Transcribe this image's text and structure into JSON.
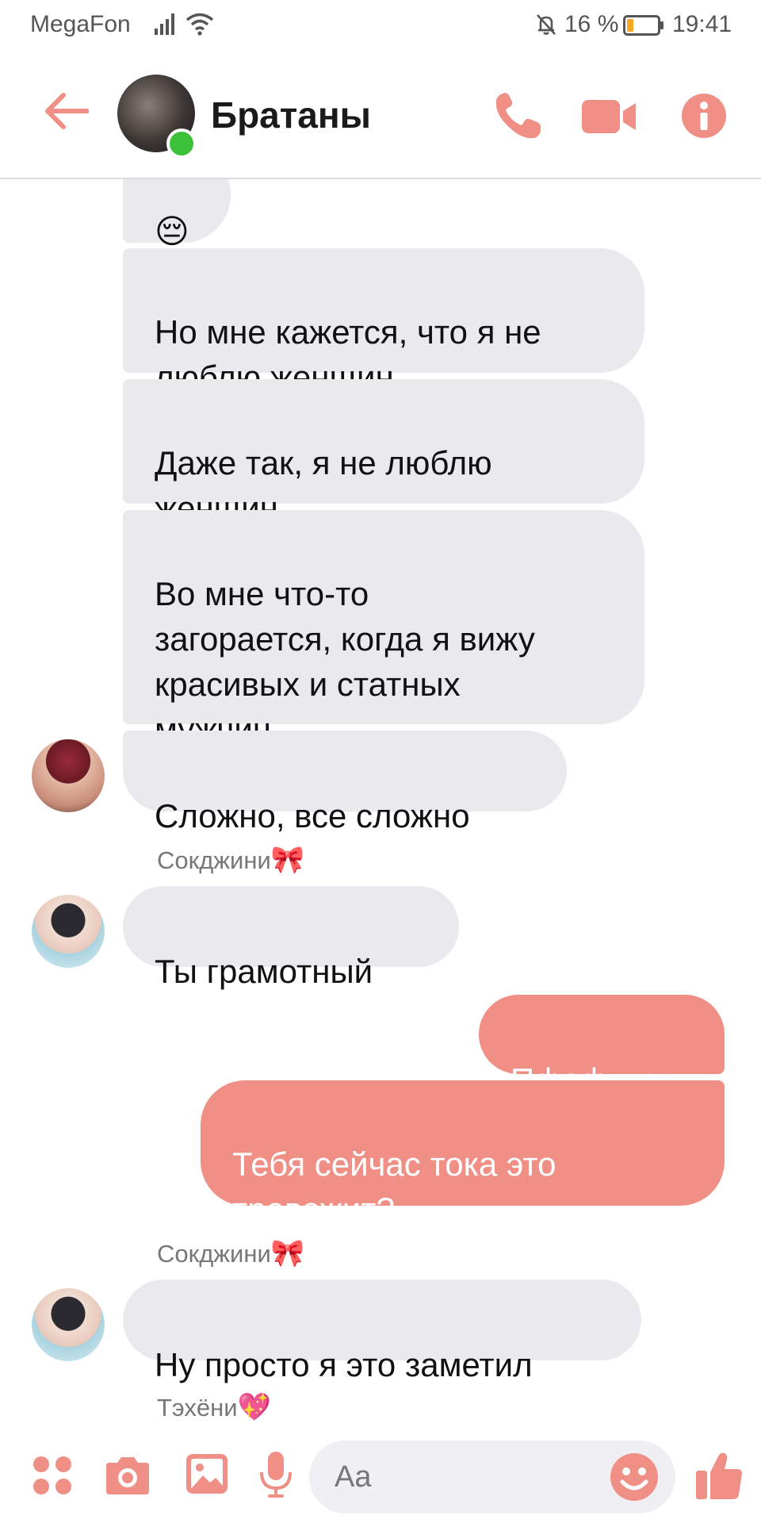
{
  "status_bar": {
    "carrier": "MegaFon",
    "battery_percent": "16 %",
    "time": "19:41"
  },
  "header": {
    "title": "Братаны",
    "online": true
  },
  "messages": [
    {
      "id": "m1",
      "direction": "incoming",
      "text": "😔"
    },
    {
      "id": "m2",
      "direction": "incoming",
      "text": "Но мне кажется, что я не\nлюблю женщин"
    },
    {
      "id": "m3",
      "direction": "incoming",
      "text": "Даже так, я не люблю\nженщин"
    },
    {
      "id": "m4",
      "direction": "incoming",
      "text": "Во мне что-то\nзагорается, когда я вижу\nкрасивых и статных\nмужчин"
    },
    {
      "id": "m5",
      "direction": "incoming",
      "text": "Сложно, все сложно"
    },
    {
      "id": "s1",
      "sender": "Сокджини",
      "sender_emoji": "🎀"
    },
    {
      "id": "m6",
      "direction": "incoming",
      "text": "Ты грамотный"
    },
    {
      "id": "m7",
      "direction": "outgoing",
      "text": "Пфофдды"
    },
    {
      "id": "m8",
      "direction": "outgoing",
      "text": "Тебя сейчас тока это\nтревожит?"
    },
    {
      "id": "s2",
      "sender": "Сокджини",
      "sender_emoji": "🎀"
    },
    {
      "id": "m9",
      "direction": "incoming",
      "text": "Ну просто я это заметил"
    },
    {
      "id": "s3",
      "sender": "Тэхёни",
      "sender_emoji": "💖"
    }
  ],
  "composer": {
    "placeholder": "Aa"
  },
  "colors": {
    "accent": "#ef8f85",
    "incoming_bubble": "#e9e9ee",
    "online": "#3cc13b",
    "battery_low": "#f5a623"
  },
  "icons": {
    "header": [
      "back-arrow-icon",
      "phone-icon",
      "video-camera-icon",
      "info-icon"
    ],
    "composer": [
      "more-dots-icon",
      "camera-icon",
      "gallery-icon",
      "microphone-icon",
      "emoji-icon",
      "thumbs-up-icon"
    ],
    "status": [
      "signal-icon",
      "wifi-icon",
      "muted-bell-icon",
      "battery-icon"
    ]
  }
}
